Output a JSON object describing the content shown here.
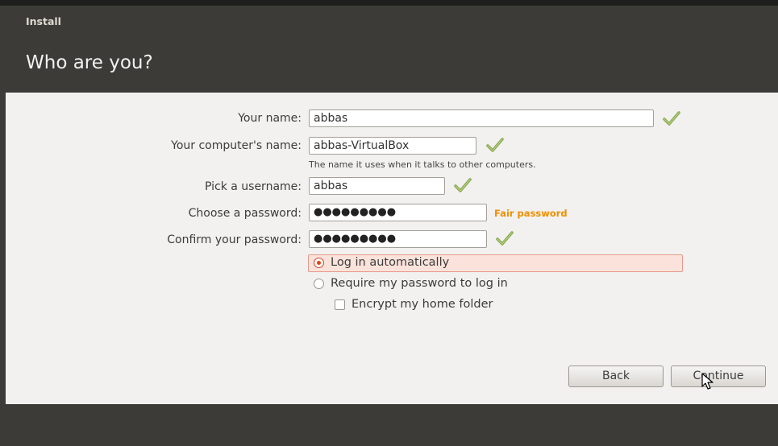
{
  "window": {
    "title": "Install"
  },
  "page": {
    "title": "Who are you?"
  },
  "form": {
    "name_label": "Your name:",
    "name_value": "abbas",
    "computer_label": "Your computer's name:",
    "computer_value": "abbas-VirtualBox",
    "computer_hint": "The name it uses when it talks to other computers.",
    "username_label": "Pick a username:",
    "username_value": "abbas",
    "password_label": "Choose a password:",
    "password_value": "●●●●●●●●●",
    "password_strength": "Fair password",
    "confirm_label": "Confirm your password:",
    "confirm_value": "●●●●●●●●●"
  },
  "login_options": {
    "auto_login": "Log in automatically",
    "require_password": "Require my password to log in",
    "encrypt_home": "Encrypt my home folder",
    "selected": "auto_login"
  },
  "buttons": {
    "back": "Back",
    "continue": "Continue"
  },
  "colors": {
    "accent": "#dd4814",
    "strength": "#ee8f00",
    "check": "#87a752"
  }
}
